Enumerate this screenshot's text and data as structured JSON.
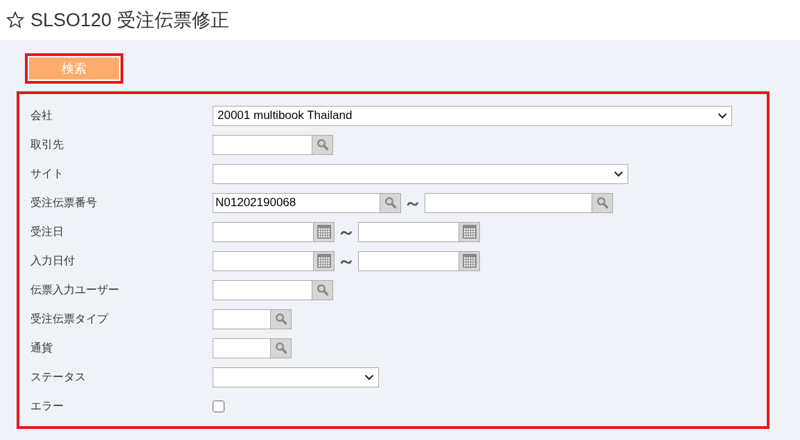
{
  "title": "SLSO120 受注伝票修正",
  "search_button": {
    "label": "検索",
    "highlighted": true
  },
  "form": {
    "highlighted": true,
    "fields": [
      {
        "label": "会社",
        "kind": "select",
        "value": "20001 multibook Thailand"
      },
      {
        "label": "取引先",
        "kind": "lookup"
      },
      {
        "label": "サイト",
        "kind": "select"
      },
      {
        "label": "受注伝票番号",
        "kind": "lookup-range",
        "from": "N01202190068",
        "separator": "～"
      },
      {
        "label": "受注日",
        "kind": "date-range",
        "separator": "～"
      },
      {
        "label": "入力日付",
        "kind": "date-range",
        "separator": "～"
      },
      {
        "label": "伝票入力ユーザー",
        "kind": "lookup"
      },
      {
        "label": "受注伝票タイプ",
        "kind": "lookup"
      },
      {
        "label": "通貨",
        "kind": "lookup"
      },
      {
        "label": "ステータス",
        "kind": "select"
      },
      {
        "label": "エラー",
        "kind": "checkbox",
        "checked": false
      }
    ]
  }
}
